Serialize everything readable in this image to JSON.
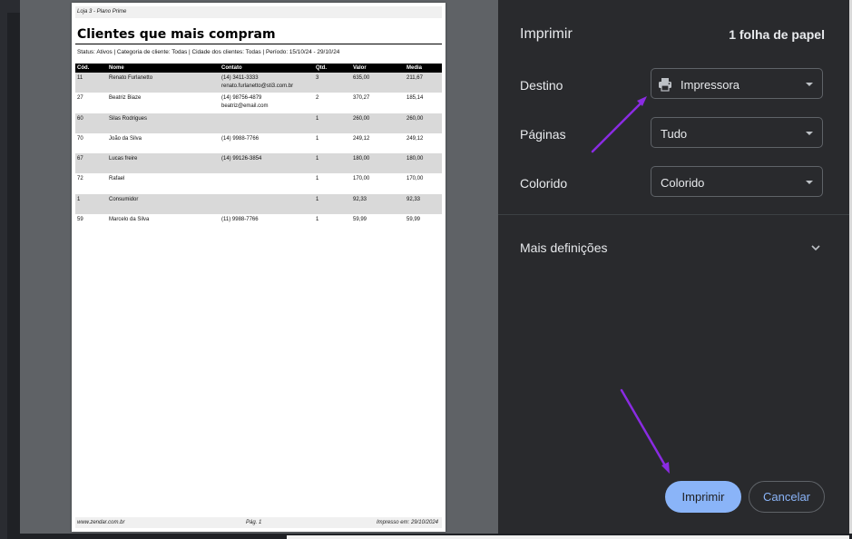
{
  "preview": {
    "header": "Loja 3 - Plano Prime",
    "title": "Clientes que mais compram",
    "status": "Status: Ativos | Categoria de cliente: Todas | Cidade dos clientes: Todas | Período: 15/10/24 - 29/10/24",
    "columns": [
      "Cód.",
      "Nome",
      "Contato",
      "Qtd.",
      "Valor",
      "Media"
    ],
    "rows": [
      {
        "cod": "11",
        "nome": "Renato Furlanetto",
        "contato": "(14) 3411-3333",
        "email": "renato.furlanetto@sti3.com.br",
        "qtd": "3",
        "valor": "635,00",
        "media": "211,67"
      },
      {
        "cod": "27",
        "nome": "Beatriz Biaze",
        "contato": "(14) 98756-4879",
        "email": "beatriz@email.com",
        "qtd": "2",
        "valor": "370,27",
        "media": "185,14"
      },
      {
        "cod": "60",
        "nome": "Silas Rodrigues",
        "contato": "",
        "email": "",
        "qtd": "1",
        "valor": "260,00",
        "media": "260,00"
      },
      {
        "cod": "70",
        "nome": "João da Silva",
        "contato": "(14) 9988-7766",
        "email": "",
        "qtd": "1",
        "valor": "249,12",
        "media": "249,12"
      },
      {
        "cod": "67",
        "nome": "Lucas freire",
        "contato": "(14) 99126-3854",
        "email": "",
        "qtd": "1",
        "valor": "180,00",
        "media": "180,00"
      },
      {
        "cod": "72",
        "nome": "Rafael",
        "contato": "",
        "email": "",
        "qtd": "1",
        "valor": "170,00",
        "media": "170,00"
      },
      {
        "cod": "1",
        "nome": "Consumidor",
        "contato": "",
        "email": "",
        "qtd": "1",
        "valor": "92,33",
        "media": "92,33"
      },
      {
        "cod": "59",
        "nome": "Marcelo da Silva",
        "contato": "(11) 9988-7766",
        "email": "",
        "qtd": "1",
        "valor": "59,99",
        "media": "59,99"
      }
    ],
    "footer_left": "www.zendar.com.br",
    "footer_center": "Pág. 1",
    "footer_right": "Impresso em: 29/10/2024"
  },
  "panel": {
    "title": "Imprimir",
    "sheets": "1 folha de papel",
    "destination_label": "Destino",
    "destination_value": "Impressora",
    "pages_label": "Páginas",
    "pages_value": "Tudo",
    "color_label": "Colorido",
    "color_value": "Colorido",
    "more_settings": "Mais definições",
    "print_button": "Imprimir",
    "cancel_button": "Cancelar"
  },
  "colors": {
    "panel_bg": "#292a2d",
    "accent": "#8ab4f8",
    "annotation_arrow": "#8a2be2"
  },
  "icons": {
    "destination": "printer-icon",
    "dropdown": "chevron-down-icon",
    "expand": "chevron-down-icon"
  }
}
